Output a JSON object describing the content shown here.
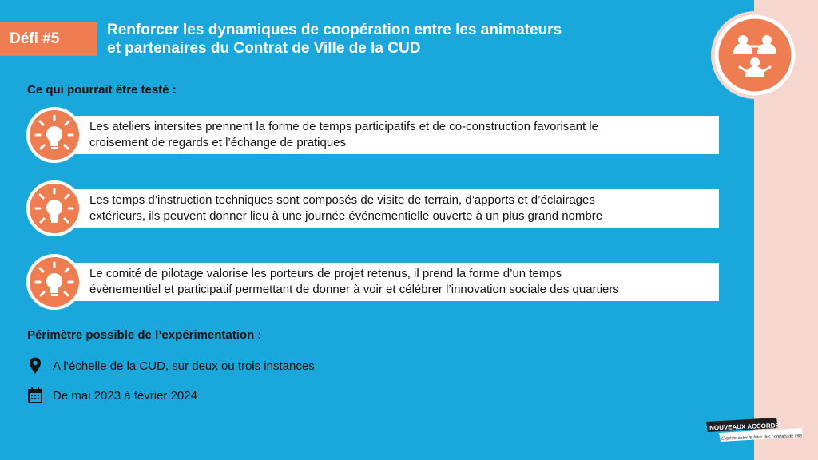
{
  "header": {
    "badge": "Défi #5",
    "title_line1": "Renforcer les dynamiques de coopération entre les animateurs",
    "title_line2": "et partenaires du Contrat de Ville de la CUD"
  },
  "section1": {
    "label": "Ce qui pourrait être testé :",
    "items": [
      {
        "text": "Les ateliers intersites prennent la forme de temps participatifs et de co-construction favorisant le\ncroisement de regards et l’échange de pratiques",
        "icon": "lightbulb-icon"
      },
      {
        "text": "Les temps d’instruction techniques sont composés de visite de terrain, d’apports et d’éclairages\nextérieurs, ils peuvent donner lieu à une journée événementielle ouverte à un plus grand nombre",
        "icon": "lightbulb-icon"
      },
      {
        "text": "Le comité de pilotage valorise les porteurs de projet retenus, il prend la forme d’un temps\névènementiel et participatif permettant de donner à voir et célébrer l’innovation sociale des quartiers",
        "icon": "lightbulb-icon"
      }
    ]
  },
  "section2": {
    "label": "Périmètre possible de l’expérimentation :",
    "location": {
      "icon": "map-pin-icon",
      "text": "A l’échelle de la CUD, sur deux ou trois instances"
    },
    "dates": {
      "icon": "calendar-icon",
      "text": "De mai 2023 à février 2024"
    }
  },
  "logo": {
    "line1": "NOUVEAUX ACCORDS",
    "line2": "Expérimenter le futur des contrats de ville"
  },
  "colors": {
    "background": "#1aa7dc",
    "accent": "#ef7d52",
    "side_strip": "#f6d7cf",
    "card": "#ffffff",
    "text": "#111111"
  }
}
